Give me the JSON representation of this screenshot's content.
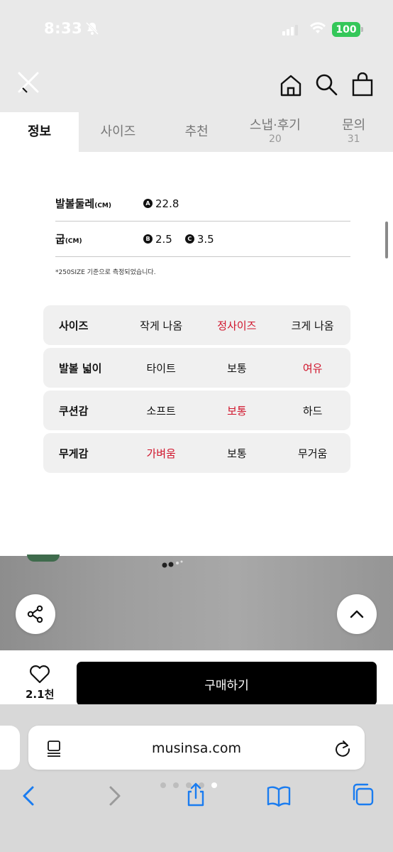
{
  "status": {
    "time": "8:33",
    "battery": "100"
  },
  "header": {
    "close_icon": "close-icon",
    "home_icon": "home-icon",
    "search_icon": "search-icon",
    "bag_icon": "shopping-bag-icon"
  },
  "tabs": [
    {
      "label": "정보",
      "count": "",
      "active": true
    },
    {
      "label": "사이즈",
      "count": ""
    },
    {
      "label": "추천",
      "count": ""
    },
    {
      "label": "스냅·후기",
      "count": "20"
    },
    {
      "label": "문의",
      "count": "31"
    }
  ],
  "specs": [
    {
      "label": "발볼둘레",
      "unit": "(CM)",
      "values": [
        {
          "badge": "A",
          "value": "22.8"
        }
      ]
    },
    {
      "label": "굽",
      "unit": "(CM)",
      "values": [
        {
          "badge": "B",
          "value": "2.5"
        },
        {
          "badge": "C",
          "value": "3.5"
        }
      ]
    }
  ],
  "footnote": "*250SIZE 기준으로 측정되었습니다.",
  "fit": [
    {
      "label": "사이즈",
      "options": [
        "작게 나옴",
        "정사이즈",
        "크게 나옴"
      ],
      "selected": 1
    },
    {
      "label": "발볼 넓이",
      "options": [
        "타이트",
        "보통",
        "여유"
      ],
      "selected": 2
    },
    {
      "label": "쿠션감",
      "options": [
        "소프트",
        "보통",
        "하드"
      ],
      "selected": 1
    },
    {
      "label": "무게감",
      "options": [
        "가벼움",
        "보통",
        "무거움"
      ],
      "selected": 0
    }
  ],
  "actions": {
    "like_count": "2.1천",
    "buy_label": "구매하기"
  },
  "browser": {
    "url": "musinsa.com"
  },
  "colors": {
    "accent_red": "#d0142b",
    "ios_blue": "#1a7cf0",
    "battery_green": "#34c759"
  }
}
